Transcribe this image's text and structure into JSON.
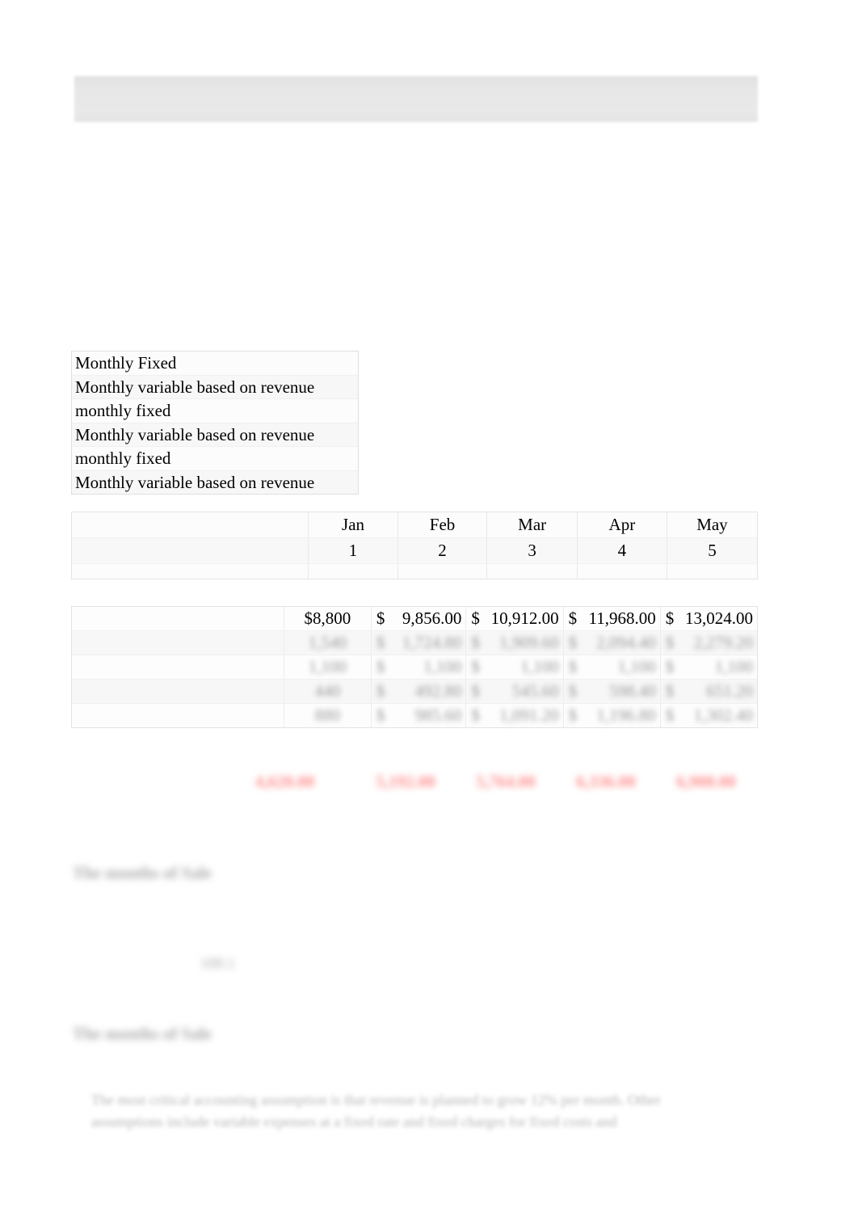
{
  "document": {
    "type": "spreadsheet-worksheet",
    "page_background": "#ffffff",
    "banner": {
      "label": "",
      "fill_color": "#e7e7e7"
    }
  },
  "descriptions": {
    "items": [
      {
        "label": "Monthly Fixed"
      },
      {
        "label": "Monthly variable based on revenue"
      },
      {
        "label": "monthly fixed"
      },
      {
        "label": "Monthly variable based on revenue"
      },
      {
        "label": "monthly fixed"
      },
      {
        "label": "Monthly variable based on revenue"
      }
    ]
  },
  "month_header": {
    "row_label": "",
    "months": [
      "Jan",
      "Feb",
      "Mar",
      "Apr",
      "May"
    ],
    "indices": [
      "1",
      "2",
      "3",
      "4",
      "5"
    ]
  },
  "data_table": {
    "revenue_row": {
      "label": "",
      "cells": [
        {
          "currency": "",
          "amount": "$8,800"
        },
        {
          "currency": "$",
          "amount": "9,856.00"
        },
        {
          "currency": "$",
          "amount": "10,912.00"
        },
        {
          "currency": "$",
          "amount": "11,968.00"
        },
        {
          "currency": "$",
          "amount": "13,024.00"
        }
      ]
    },
    "obscured_rows": [
      {
        "label": "",
        "cells": [
          {
            "currency": "",
            "amount": "1,540"
          },
          {
            "currency": "$",
            "amount": "1,724.80"
          },
          {
            "currency": "$",
            "amount": "1,909.60"
          },
          {
            "currency": "$",
            "amount": "2,094.40"
          },
          {
            "currency": "$",
            "amount": "2,279.20"
          }
        ]
      },
      {
        "label": "",
        "cells": [
          {
            "currency": "",
            "amount": "1,100"
          },
          {
            "currency": "$",
            "amount": "1,100"
          },
          {
            "currency": "$",
            "amount": "1,100"
          },
          {
            "currency": "$",
            "amount": "1,100"
          },
          {
            "currency": "$",
            "amount": "1,100"
          }
        ]
      },
      {
        "label": "",
        "cells": [
          {
            "currency": "",
            "amount": "440"
          },
          {
            "currency": "$",
            "amount": "492.80"
          },
          {
            "currency": "$",
            "amount": "545.60"
          },
          {
            "currency": "$",
            "amount": "598.40"
          },
          {
            "currency": "$",
            "amount": "651.20"
          }
        ]
      },
      {
        "label": "",
        "cells": [
          {
            "currency": "",
            "amount": "880"
          },
          {
            "currency": "$",
            "amount": "985.60"
          },
          {
            "currency": "$",
            "amount": "1,091.20"
          },
          {
            "currency": "$",
            "amount": "1,196.80"
          },
          {
            "currency": "$",
            "amount": "1,302.40"
          }
        ]
      }
    ]
  },
  "totals_row": {
    "color": "#ff8d8d",
    "cells": [
      {
        "value": "4,620.00"
      },
      {
        "value": "5,192.00"
      },
      {
        "value": "5,764.00"
      },
      {
        "value": "6,336.00"
      },
      {
        "value": "6,908.00"
      }
    ]
  },
  "notes": {
    "line_1": "The months of Sale",
    "line_2": "The months of Sale",
    "small_value": "100.1"
  },
  "bottom_paragraph": {
    "line_1": "The most critical accounting assumption is that revenue is planned to grow 12% per month. Other",
    "line_2": "assumptions include variable expenses at a fixed rate and fixed charges for fixed costs and"
  }
}
